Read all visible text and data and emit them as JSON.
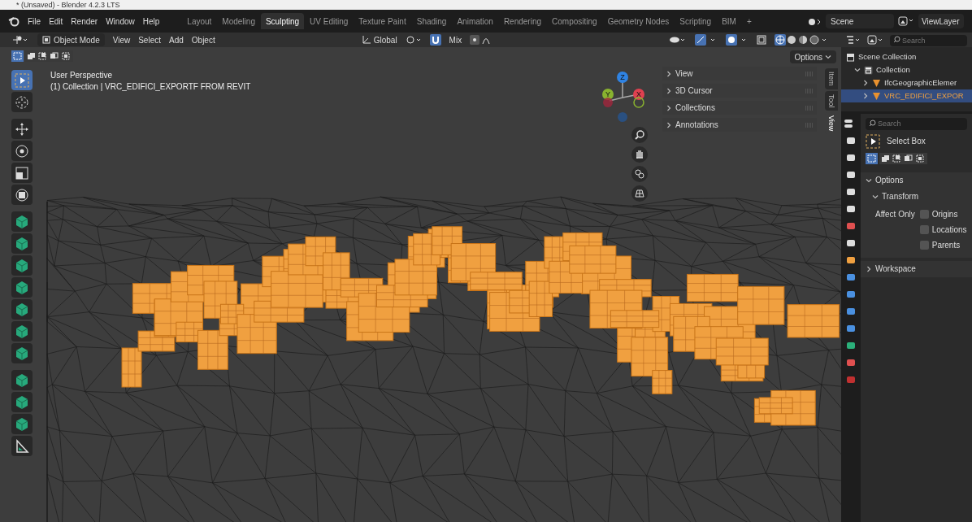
{
  "window": {
    "title": "* (Unsaved) - Blender 4.2.3 LTS"
  },
  "menu": [
    "File",
    "Edit",
    "Render",
    "Window",
    "Help"
  ],
  "workspaces": [
    {
      "label": "Layout",
      "selected": false
    },
    {
      "label": "Modeling",
      "selected": false
    },
    {
      "label": "Sculpting",
      "selected": true
    },
    {
      "label": "UV Editing",
      "selected": false
    },
    {
      "label": "Texture Paint",
      "selected": false
    },
    {
      "label": "Shading",
      "selected": false
    },
    {
      "label": "Animation",
      "selected": false
    },
    {
      "label": "Rendering",
      "selected": false
    },
    {
      "label": "Compositing",
      "selected": false
    },
    {
      "label": "Geometry Nodes",
      "selected": false
    },
    {
      "label": "Scripting",
      "selected": false
    },
    {
      "label": "BIM",
      "selected": false
    },
    {
      "label": "+",
      "selected": false
    }
  ],
  "scene": "Scene",
  "view_layer": "ViewLayer",
  "viewport_header": {
    "mode": "Object Mode",
    "menus": [
      "View",
      "Select",
      "Add",
      "Object"
    ],
    "orientation": "Global",
    "snap": "Mix",
    "options": "Options"
  },
  "overlay_text": [
    "User Perspective",
    "(1) Collection | VRC_EDIFICI_EXPORTF FROM REVIT"
  ],
  "tools": [
    {
      "kind": "select",
      "selected": true
    },
    {
      "kind": "cursor",
      "selected": false
    },
    {
      "kind": "move",
      "selected": false
    },
    {
      "kind": "rotate",
      "selected": false
    },
    {
      "kind": "scale",
      "selected": false
    },
    {
      "kind": "transform",
      "selected": false
    },
    {
      "kind": "bim",
      "selected": false
    },
    {
      "kind": "bim",
      "selected": false
    },
    {
      "kind": "bim",
      "selected": false
    },
    {
      "kind": "bim",
      "selected": false
    },
    {
      "kind": "bim",
      "selected": false
    },
    {
      "kind": "bim",
      "selected": false
    },
    {
      "kind": "bim",
      "selected": false
    },
    {
      "kind": "bim",
      "selected": false
    },
    {
      "kind": "bim",
      "selected": false
    },
    {
      "kind": "bim",
      "selected": false
    },
    {
      "kind": "measure",
      "selected": false
    }
  ],
  "gizmo_axes": [
    "Z",
    "Y",
    "X"
  ],
  "sidebar_panels": [
    {
      "label": "View",
      "expanded": false
    },
    {
      "label": "3D Cursor",
      "expanded": false
    },
    {
      "label": "Collections",
      "expanded": false
    },
    {
      "label": "Annotations",
      "expanded": false
    }
  ],
  "sidebar_tabs": [
    {
      "label": "Item",
      "selected": false
    },
    {
      "label": "Tool",
      "selected": false
    },
    {
      "label": "View",
      "selected": true
    }
  ],
  "outliner": {
    "search_placeholder": "Search",
    "tree": [
      {
        "label": "Scene Collection",
        "kind": "scene",
        "selected": false,
        "children": [
          {
            "label": "Collection",
            "kind": "collection",
            "expanded": true,
            "selected": false,
            "children": [
              {
                "label": "IfcGeographicElemer",
                "kind": "object",
                "expanded": false,
                "selected": false
              },
              {
                "label": "VRC_EDIFICI_EXPOR",
                "kind": "object",
                "expanded": false,
                "selected": true
              }
            ]
          }
        ]
      }
    ]
  },
  "properties": {
    "search_placeholder": "Search",
    "tool": "Select Box",
    "sections": [
      {
        "label": "Options",
        "expanded": true
      },
      {
        "label": "Transform",
        "expanded": true
      }
    ],
    "affect_only": {
      "label": "Affect Only",
      "options": [
        {
          "label": "Origins",
          "checked": false
        },
        {
          "label": "Locations",
          "checked": false
        },
        {
          "label": "Parents",
          "checked": false
        }
      ]
    },
    "workspace": {
      "label": "Workspace",
      "expanded": false
    }
  }
}
